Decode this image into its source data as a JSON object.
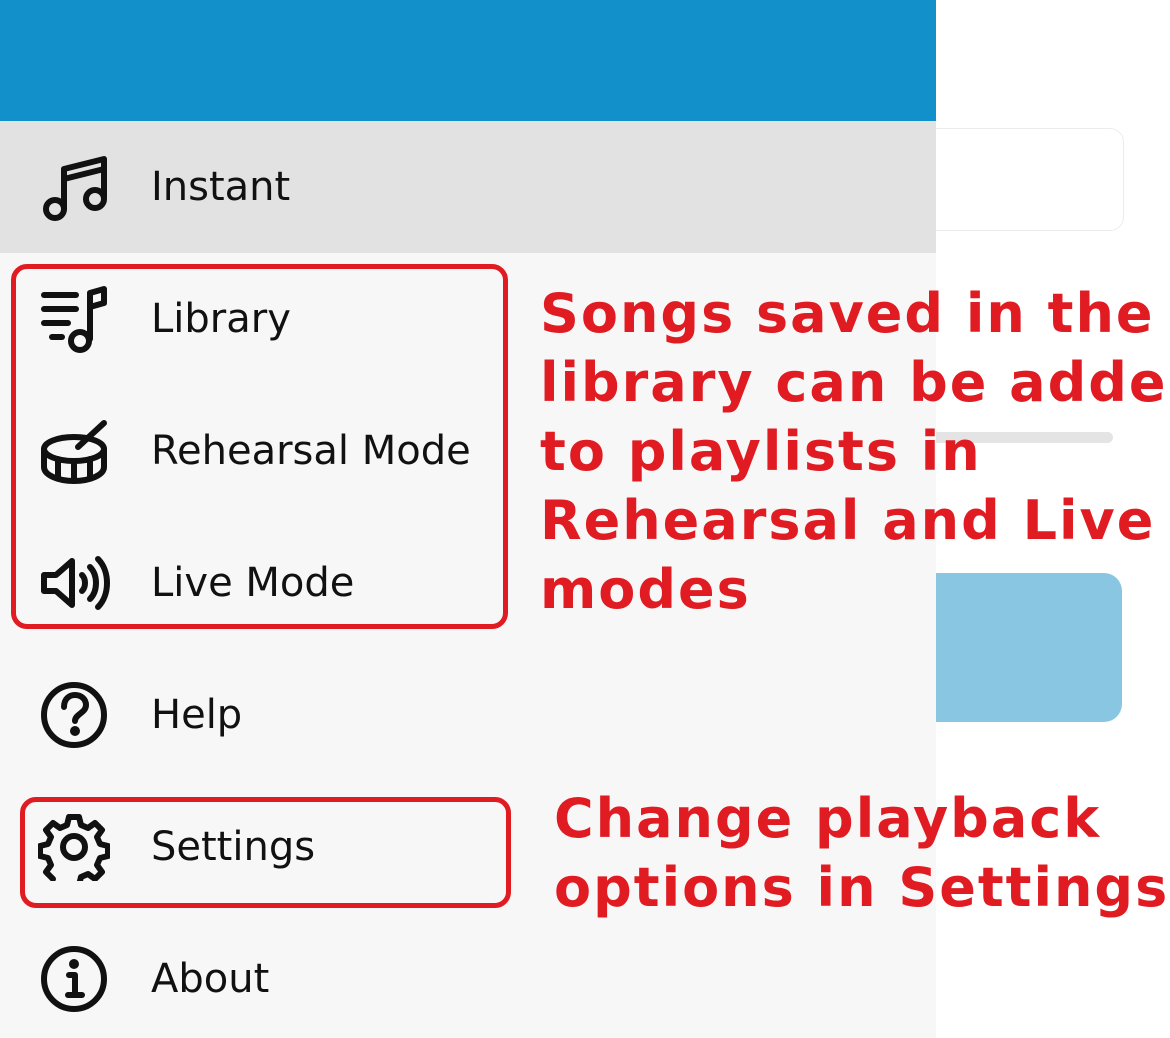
{
  "drawer": {
    "items": [
      {
        "label": "Instant",
        "icon": "music-notes-icon",
        "selected": true
      },
      {
        "label": "Library",
        "icon": "music-library-icon",
        "selected": false
      },
      {
        "label": "Rehearsal Mode",
        "icon": "drum-icon",
        "selected": false
      },
      {
        "label": "Live Mode",
        "icon": "speaker-icon",
        "selected": false
      },
      {
        "label": "Help",
        "icon": "help-icon",
        "selected": false
      },
      {
        "label": "Settings",
        "icon": "gear-icon",
        "selected": false
      },
      {
        "label": "About",
        "icon": "info-icon",
        "selected": false
      }
    ]
  },
  "annotations": {
    "modes_note": {
      "lines": [
        "Songs saved in the",
        "library can be added",
        "to playlists in",
        "Rehearsal and Live",
        "modes"
      ]
    },
    "settings_note": {
      "lines": [
        "Change playback",
        "options in Settings"
      ]
    }
  },
  "colors": {
    "header": "#1190c9",
    "drawer_background": "#f7f7f7",
    "selected_item": "#e2e2e2",
    "annotation": "#e01b22",
    "background_button": "#89c6e2"
  }
}
